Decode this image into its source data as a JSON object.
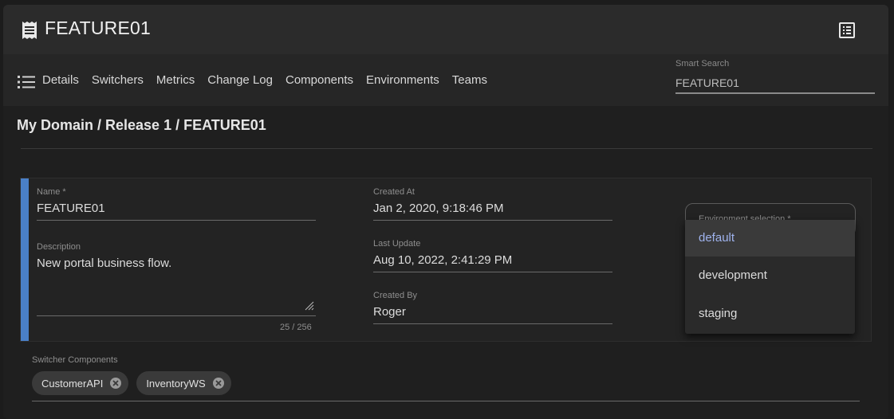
{
  "header": {
    "title": "FEATURE01",
    "title_icon": "receipt-icon",
    "action_icon": "list-alt-icon"
  },
  "nav": {
    "menu_icon": "menu-icon",
    "tabs": [
      {
        "label": "Details"
      },
      {
        "label": "Switchers"
      },
      {
        "label": "Metrics"
      },
      {
        "label": "Change Log"
      },
      {
        "label": "Components"
      },
      {
        "label": "Environments"
      },
      {
        "label": "Teams"
      }
    ],
    "smart_search": {
      "label": "Smart Search",
      "value": "FEATURE01"
    }
  },
  "breadcrumb": "My Domain / Release 1 / FEATURE01",
  "form": {
    "name": {
      "label": "Name *",
      "value": "FEATURE01"
    },
    "description": {
      "label": "Description",
      "value": "New portal business flow.",
      "counter": "25 / 256"
    },
    "created_at": {
      "label": "Created At",
      "value": "Jan 2, 2020, 9:18:46 PM"
    },
    "last_update": {
      "label": "Last Update",
      "value": "Aug 10, 2022, 2:41:29 PM"
    },
    "created_by": {
      "label": "Created By",
      "value": "Roger"
    },
    "environment": {
      "label": "Environment selection *",
      "options": [
        "default",
        "development",
        "staging"
      ],
      "selected": "default"
    }
  },
  "components": {
    "label": "Switcher Components",
    "chips": [
      "CustomerAPI",
      "InventoryWS"
    ]
  },
  "colors": {
    "accent": "#4a80c8",
    "selected_option": "#9fb3ee"
  }
}
